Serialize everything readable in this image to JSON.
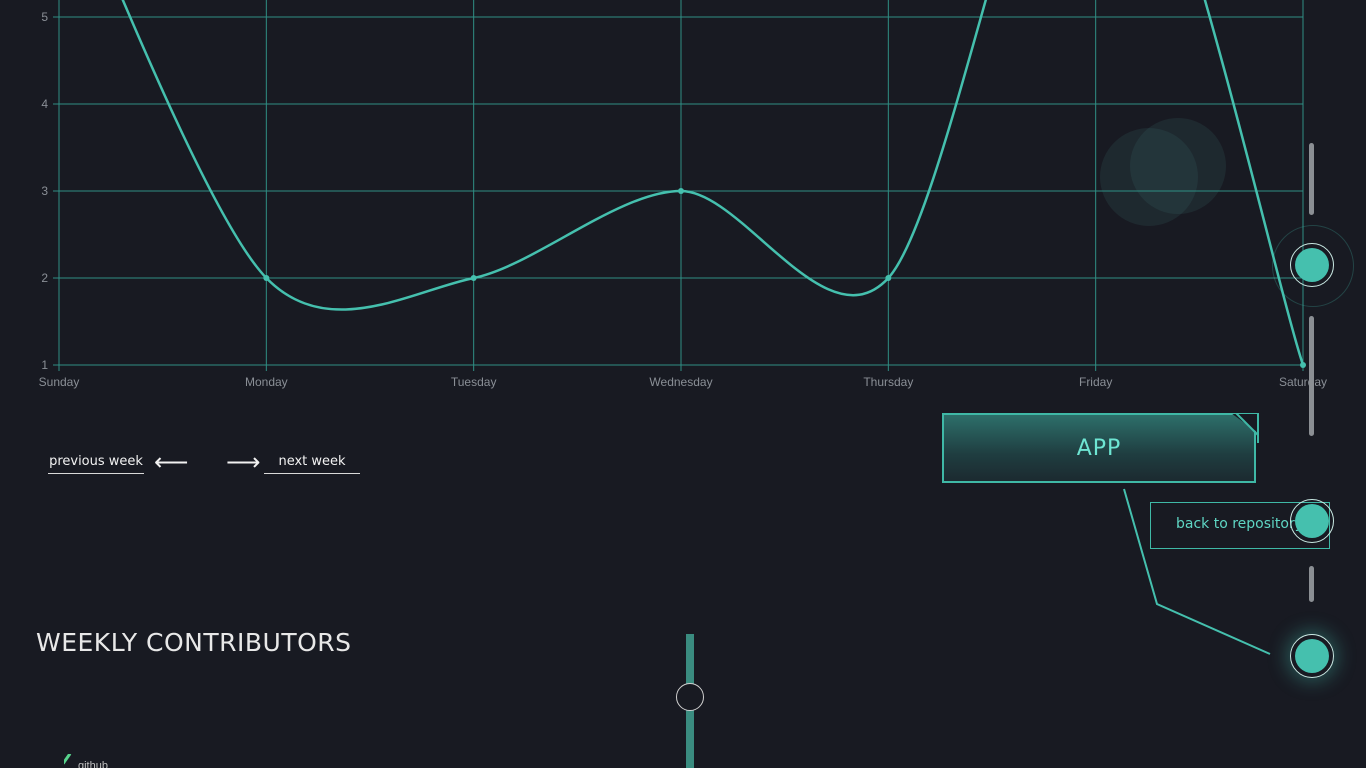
{
  "colors": {
    "background": "#181a22",
    "accent": "#45c0ae",
    "grid": "#2f8f84",
    "line": "#45c0ae",
    "muted_text": "#8a8f96"
  },
  "chart_data": {
    "type": "line",
    "categories": [
      "Sunday",
      "Monday",
      "Tuesday",
      "Wednesday",
      "Thursday",
      "Friday",
      "Saturday"
    ],
    "series": [
      {
        "values": [
          6.9,
          2,
          2,
          3,
          2,
          8.2,
          1
        ]
      }
    ],
    "y_ticks": [
      1,
      2,
      3,
      4,
      5
    ],
    "ylim": [
      1,
      5
    ],
    "grid": true,
    "title": "",
    "xlabel": "",
    "ylabel": ""
  },
  "week_nav": {
    "previous_label": "previous week",
    "next_label": "next week",
    "previous_icon": "arrow-left-icon",
    "next_icon": "arrow-right-icon",
    "left_arrow_glyph": "⟵",
    "right_arrow_glyph": "⟶"
  },
  "app_button": {
    "label": "APP"
  },
  "back_button": {
    "label": "back to repository"
  },
  "contributors": {
    "title": "WEEKLY CONTRIBUTORS",
    "first_avatar_alt": "github"
  }
}
